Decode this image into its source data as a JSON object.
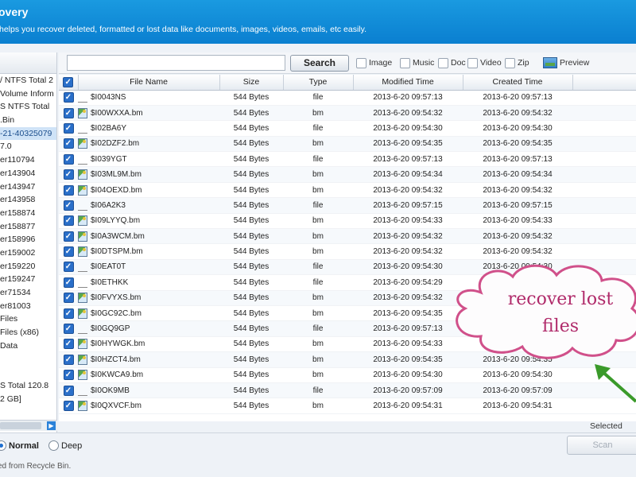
{
  "header": {
    "title": "overy",
    "subtitle": "helps you recover deleted, formatted or lost data like documents, images, videos, emails, etc easily."
  },
  "tree": {
    "items": [
      {
        "label": "/ NTFS Total 2",
        "selected": false
      },
      {
        "label": "Volume Inform",
        "selected": false
      },
      {
        "label": "S NTFS Total",
        "selected": false
      },
      {
        "label": ".Bin",
        "selected": false
      },
      {
        "label": "-21-40325079",
        "selected": true
      },
      {
        "label": "7.0",
        "selected": false
      },
      {
        "label": "er110794",
        "selected": false
      },
      {
        "label": "er143904",
        "selected": false
      },
      {
        "label": "er143947",
        "selected": false
      },
      {
        "label": "er143958",
        "selected": false
      },
      {
        "label": "er158874",
        "selected": false
      },
      {
        "label": "er158877",
        "selected": false
      },
      {
        "label": "er158996",
        "selected": false
      },
      {
        "label": "er159002",
        "selected": false
      },
      {
        "label": "er159220",
        "selected": false
      },
      {
        "label": "er159247",
        "selected": false
      },
      {
        "label": "er71534",
        "selected": false
      },
      {
        "label": "er81003",
        "selected": false
      },
      {
        "label": "Files",
        "selected": false
      },
      {
        "label": "Files (x86)",
        "selected": false
      },
      {
        "label": "Data",
        "selected": false
      },
      {
        "label": "",
        "selected": false
      },
      {
        "label": "",
        "selected": false
      },
      {
        "label": "S Total 120.8",
        "selected": false
      },
      {
        "label": "2 GB]",
        "selected": false
      }
    ]
  },
  "toolbar": {
    "search_value": "",
    "search_label": "Search",
    "filters": [
      "Image",
      "Music",
      "Doc",
      "Video",
      "Zip"
    ],
    "preview_label": "Preview"
  },
  "table": {
    "columns": [
      "File Name",
      "Size",
      "Type",
      "Modified Time",
      "Created Time"
    ],
    "rows": [
      {
        "name": "$I0043NS",
        "size": "544 Bytes",
        "type": "file",
        "modified": "2013-6-20 09:57:13",
        "created": "2013-6-20 09:57:13"
      },
      {
        "name": "$I00WXXA.bm",
        "size": "544 Bytes",
        "type": "bm",
        "modified": "2013-6-20 09:54:32",
        "created": "2013-6-20 09:54:32"
      },
      {
        "name": "$I02BA6Y",
        "size": "544 Bytes",
        "type": "file",
        "modified": "2013-6-20 09:54:30",
        "created": "2013-6-20 09:54:30"
      },
      {
        "name": "$I02DZF2.bm",
        "size": "544 Bytes",
        "type": "bm",
        "modified": "2013-6-20 09:54:35",
        "created": "2013-6-20 09:54:35"
      },
      {
        "name": "$I039YGT",
        "size": "544 Bytes",
        "type": "file",
        "modified": "2013-6-20 09:57:13",
        "created": "2013-6-20 09:57:13"
      },
      {
        "name": "$I03ML9M.bm",
        "size": "544 Bytes",
        "type": "bm",
        "modified": "2013-6-20 09:54:34",
        "created": "2013-6-20 09:54:34"
      },
      {
        "name": "$I04OEXD.bm",
        "size": "544 Bytes",
        "type": "bm",
        "modified": "2013-6-20 09:54:32",
        "created": "2013-6-20 09:54:32"
      },
      {
        "name": "$I06A2K3",
        "size": "544 Bytes",
        "type": "file",
        "modified": "2013-6-20 09:57:15",
        "created": "2013-6-20 09:57:15"
      },
      {
        "name": "$I09LYYQ.bm",
        "size": "544 Bytes",
        "type": "bm",
        "modified": "2013-6-20 09:54:33",
        "created": "2013-6-20 09:54:33"
      },
      {
        "name": "$I0A3WCM.bm",
        "size": "544 Bytes",
        "type": "bm",
        "modified": "2013-6-20 09:54:32",
        "created": "2013-6-20 09:54:32"
      },
      {
        "name": "$I0DTSPM.bm",
        "size": "544 Bytes",
        "type": "bm",
        "modified": "2013-6-20 09:54:32",
        "created": "2013-6-20 09:54:32"
      },
      {
        "name": "$I0EAT0T",
        "size": "544 Bytes",
        "type": "file",
        "modified": "2013-6-20 09:54:30",
        "created": "2013-6-20 09:54:30"
      },
      {
        "name": "$I0ETHKK",
        "size": "544 Bytes",
        "type": "file",
        "modified": "2013-6-20 09:54:29",
        "created": ""
      },
      {
        "name": "$I0FVYXS.bm",
        "size": "544 Bytes",
        "type": "bm",
        "modified": "2013-6-20 09:54:32",
        "created": ""
      },
      {
        "name": "$I0GC92C.bm",
        "size": "544 Bytes",
        "type": "bm",
        "modified": "2013-6-20 09:54:35",
        "created": ""
      },
      {
        "name": "$I0GQ9GP",
        "size": "544 Bytes",
        "type": "file",
        "modified": "2013-6-20 09:57:13",
        "created": ""
      },
      {
        "name": "$I0HYWGK.bm",
        "size": "544 Bytes",
        "type": "bm",
        "modified": "2013-6-20 09:54:33",
        "created": ""
      },
      {
        "name": "$I0HZCT4.bm",
        "size": "544 Bytes",
        "type": "bm",
        "modified": "2013-6-20 09:54:35",
        "created": "2013-6-20 09:54:35"
      },
      {
        "name": "$I0KWCA9.bm",
        "size": "544 Bytes",
        "type": "bm",
        "modified": "2013-6-20 09:54:30",
        "created": "2013-6-20 09:54:30"
      },
      {
        "name": "$I0OK9MB",
        "size": "544 Bytes",
        "type": "file",
        "modified": "2013-6-20 09:57:09",
        "created": "2013-6-20 09:57:09"
      },
      {
        "name": "$I0QXVCF.bm",
        "size": "544 Bytes",
        "type": "bm",
        "modified": "2013-6-20 09:54:31",
        "created": "2013-6-20 09:54:31"
      }
    ]
  },
  "selected_label": "Selected",
  "scan_mode": {
    "normal": "Normal",
    "deep": "Deep"
  },
  "scan_button": "Scan",
  "status_text": "ed from Recycle Bin.",
  "callout": {
    "text": "recover lost files"
  },
  "colors": {
    "header": "#0a7fd0",
    "callout_border": "#d0508a",
    "callout_text": "#b02a6a",
    "arrow": "#3a9a2a"
  }
}
